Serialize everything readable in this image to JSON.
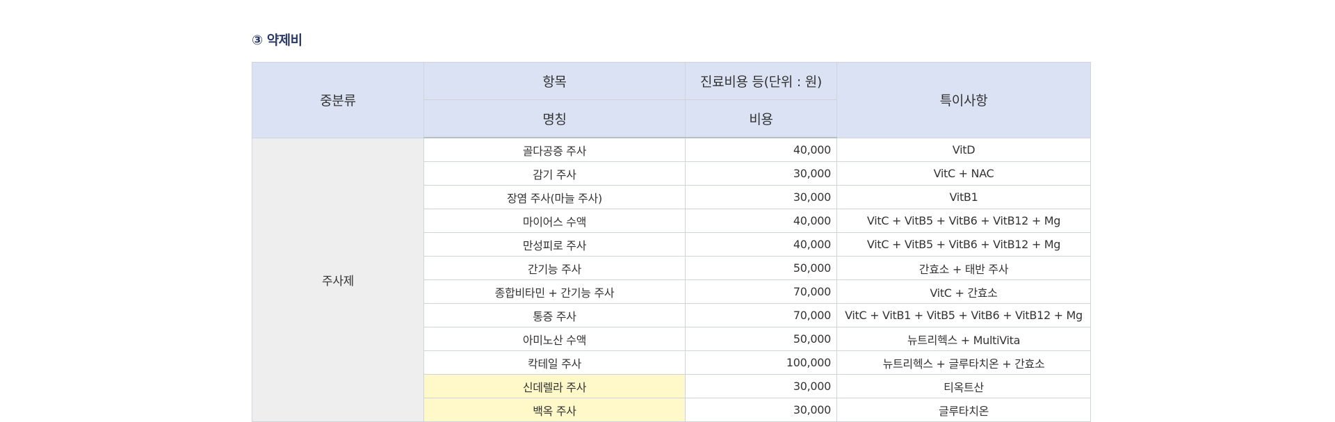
{
  "section": {
    "title": "③ 약제비"
  },
  "table": {
    "headers": {
      "category": "중분류",
      "item_group": "항목",
      "item_name": "명칭",
      "cost_group": "진료비용 등(단위 : 원)",
      "cost": "비용",
      "notes": "특이사항"
    },
    "category_label": "주사제",
    "rows": [
      {
        "name": "골다공증 주사",
        "cost": "40,000",
        "note": "VitD",
        "highlight": false
      },
      {
        "name": "감기 주사",
        "cost": "30,000",
        "note": "VitC + NAC",
        "highlight": false
      },
      {
        "name": "장염 주사(마늘 주사)",
        "cost": "30,000",
        "note": "VitB1",
        "highlight": false
      },
      {
        "name": "마이어스 수액",
        "cost": "40,000",
        "note": "VitC + VitB5 + VitB6 + VitB12 + Mg",
        "highlight": false
      },
      {
        "name": "만성피로 주사",
        "cost": "40,000",
        "note": "VitC + VitB5 + VitB6 + VitB12 + Mg",
        "highlight": false
      },
      {
        "name": "간기능 주사",
        "cost": "50,000",
        "note": "간효소 + 태반 주사",
        "highlight": false
      },
      {
        "name": "종합비타민 + 간기능 주사",
        "cost": "70,000",
        "note": "VitC + 간효소",
        "highlight": false
      },
      {
        "name": "통증 주사",
        "cost": "70,000",
        "note": "VitC + VitB1 + VitB5 + VitB6 + VitB12 + Mg",
        "highlight": false
      },
      {
        "name": "아미노산 수액",
        "cost": "50,000",
        "note": "뉴트리헥스 + MultiVita",
        "highlight": false
      },
      {
        "name": "칵테일 주사",
        "cost": "100,000",
        "note": "뉴트리헥스 + 글루타치온 + 간효소",
        "highlight": false
      },
      {
        "name": "신데렐라 주사",
        "cost": "30,000",
        "note": "티옥트산",
        "highlight": true
      },
      {
        "name": "백옥 주사",
        "cost": "30,000",
        "note": "글루타치온",
        "highlight": true
      }
    ],
    "colors": {
      "header_bg": "#dbe2f3",
      "category_bg": "#eeeeee",
      "highlight_bg": "#fff8c9",
      "title_color": "#2b3a66",
      "border": "#cfd4dc"
    }
  }
}
